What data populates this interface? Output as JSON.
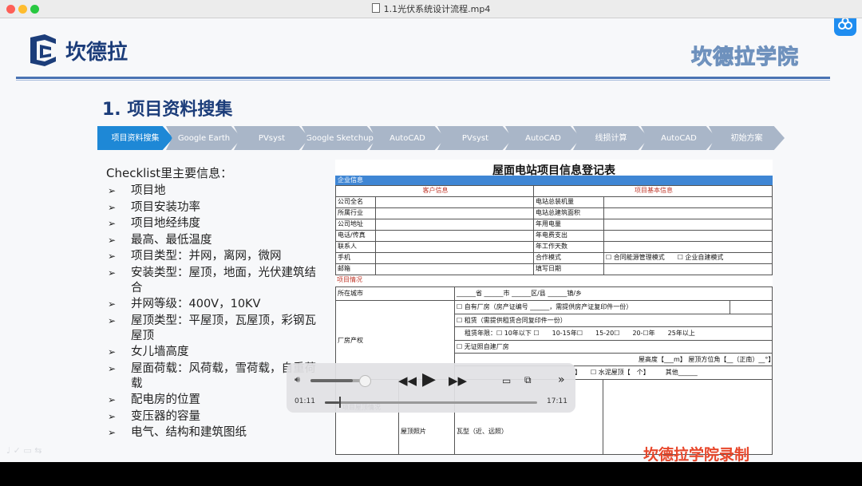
{
  "window": {
    "title": "1.1光伏系统设计流程.mp4"
  },
  "slide": {
    "logo_text": "坎德拉",
    "academy_text": "坎德拉学院",
    "heading": "1. 项目资料搜集",
    "recorded_by": "坎德拉学院录制",
    "watermark": "♩ ✓ ▭ ⇆"
  },
  "flow": [
    {
      "label": "项目资料搜集"
    },
    {
      "label": "Google Earth"
    },
    {
      "label": "PVsyst"
    },
    {
      "label": "Google Sketchup"
    },
    {
      "label": "AutoCAD"
    },
    {
      "label": "PVsyst"
    },
    {
      "label": "AutoCAD"
    },
    {
      "label": "线损计算"
    },
    {
      "label": "AutoCAD"
    },
    {
      "label": "初始方案"
    }
  ],
  "checklist": {
    "title": "Checklist里主要信息：",
    "bullet": "➢",
    "items": [
      "项目地",
      "项目安装功率",
      "项目地经纬度",
      "最高、最低温度",
      "项目类型：并网，离网，微网",
      "安装类型：屋顶，地面，光伏建筑结合",
      "并网等级：400V，10KV",
      "屋顶类型：平屋顶，瓦屋顶，彩钢瓦屋顶",
      "女儿墙高度",
      "屋面荷载：风荷载，雪荷载，自重荷载",
      "配电房的位置",
      "变压器的容量",
      "电气、结构和建筑图纸"
    ]
  },
  "form": {
    "title": "屋面电站项目信息登记表",
    "section1": "企业信息",
    "customer_header": "客户信息",
    "project_header": "项目基本信息",
    "left_labels": [
      "公司全名",
      "所属行业",
      "公司地址",
      "电话/传真",
      "联系人",
      "手机",
      "邮箱"
    ],
    "right_labels": [
      "电站总装机量",
      "电站总建筑面积",
      "年用电量",
      "年电费支出",
      "年工作天数",
      "合作模式",
      "填写日期"
    ],
    "coop_options": "☐ 合同能源管理模式　　☐ 企业自建模式",
    "section2": "项目情况",
    "city_label": "所在城市",
    "city_value": "______省 ______市 ______区/县 ______镇/乡",
    "property_label": "厂房产权",
    "own_line": "☐ 自有厂房（房产证编号 ______，需提供房产证复印件一份）",
    "lease_line": "☐ 租赁（需提供租赁合同复印件一份）",
    "lease_years": "租赁年限：☐  10年以下 ☐　　10-15年☐　　15-20☐　　20-☐年　　25年以上",
    "no_cert": "☐ 无证照自建厂房",
    "roof_height": "屋高度【___m】 屋顶方位角【__（正南）__°】",
    "roof_type": "】　　☐  水泥屋顶【　个】　　　其他______",
    "roof_label": "项目屋顶情况",
    "roof_photo": "屋顶照片",
    "tile_line": "瓦型（近、远照）"
  },
  "player": {
    "current_time": "01:11",
    "total_time": "17:11",
    "progress": 0.069,
    "volume": 0.75
  }
}
